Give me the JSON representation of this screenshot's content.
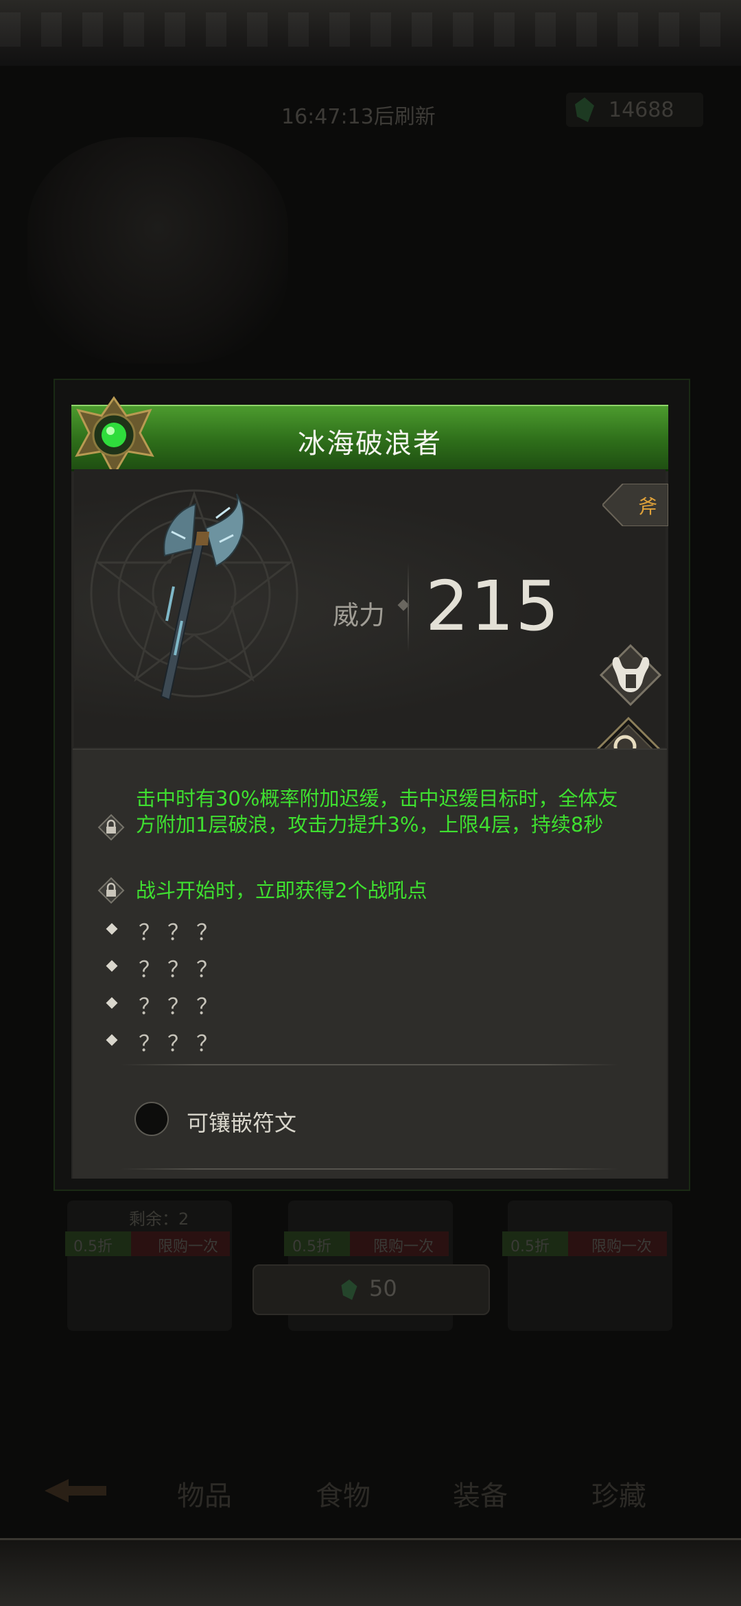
{
  "background": {
    "refresh_text": "16:47:13后刷新",
    "currency_amount": "14688",
    "remaining_label": "剩余：2",
    "shop_items": [
      {
        "discount": "0.5折",
        "limit": "限购一次"
      },
      {
        "discount": "0.5折",
        "limit": "限购一次"
      },
      {
        "discount": "0.5折",
        "limit": "限购一次"
      }
    ],
    "price": "50",
    "nav_tabs": [
      "物品",
      "食物",
      "装备",
      "珍藏"
    ]
  },
  "item": {
    "name": "冰海破浪者",
    "type": "斧",
    "power_label": "威力",
    "power_value": "215",
    "skills": [
      "击中时有30%概率附加迟缓，击中迟缓目标时，全体友方附加1层破浪，攻击力提升3%，上限4层，持续8秒",
      "战斗开始时，立即获得2个战吼点"
    ],
    "hidden_skills": [
      "？？？",
      "？？？",
      "？？？",
      "？？？"
    ],
    "rune_label": "可镶嵌符文"
  },
  "colors": {
    "title_green": "#3c8a24",
    "skill_text": "#3fe030",
    "type_text": "#e0a23a"
  },
  "icons": [
    "gem-icon",
    "emblem-icon",
    "axe-icon",
    "faction-helmet-icon",
    "search-icon",
    "lock-icon"
  ]
}
